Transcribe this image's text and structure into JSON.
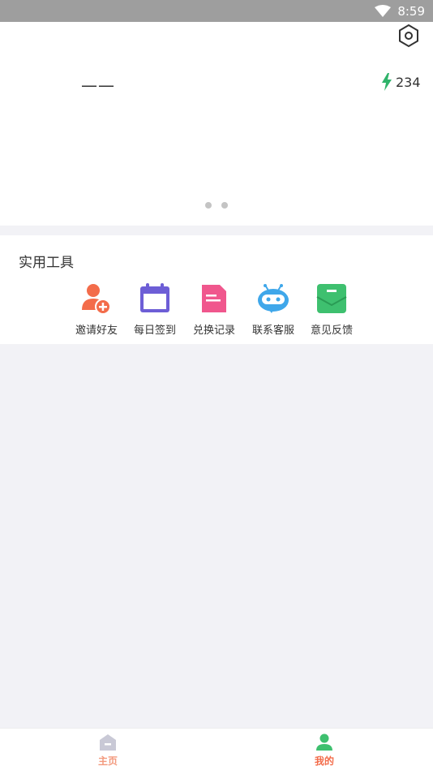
{
  "status_bar": {
    "time": "8:59"
  },
  "header": {
    "username": "——",
    "energy_count": "234",
    "carousel_pages": 2
  },
  "tools": {
    "title": "实用工具",
    "items": [
      {
        "label": "邀请好友",
        "icon": "add-user-icon",
        "color": "#f36c4a"
      },
      {
        "label": "每日签到",
        "icon": "calendar-icon",
        "color": "#6d5ed6"
      },
      {
        "label": "兑换记录",
        "icon": "document-icon",
        "color": "#f0578d"
      },
      {
        "label": "联系客服",
        "icon": "robot-icon",
        "color": "#3fa7ea"
      },
      {
        "label": "意见反馈",
        "icon": "mailbox-icon",
        "color": "#3ec06f"
      }
    ]
  },
  "bottom_nav": {
    "items": [
      {
        "label": "主页",
        "active": false
      },
      {
        "label": "我的",
        "active": true
      }
    ],
    "active_color": "#f36c4a",
    "inactive_color": "#f39a7e"
  }
}
